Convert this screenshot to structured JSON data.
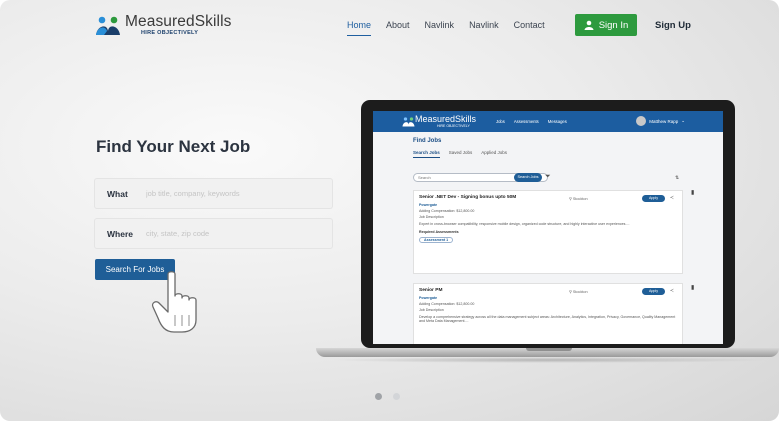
{
  "brand": {
    "name": "MeasuredSkills",
    "tagline": "HIRE OBJECTIVELY",
    "colors": {
      "blue": "#1f5e97",
      "green": "#2d9a3e"
    }
  },
  "nav": {
    "items": [
      "Home",
      "About",
      "Navlink",
      "Navlink",
      "Contact"
    ],
    "active": "Home"
  },
  "auth": {
    "sign_in": "Sign In",
    "sign_up": "Sign Up"
  },
  "hero": {
    "title": "Find Your Next Job",
    "what_label": "What",
    "what_placeholder": "job title, company, keywords",
    "where_label": "Where",
    "where_placeholder": "city, state, zip code",
    "search_button": "Search For Jobs"
  },
  "preview": {
    "logo": "MeasuredSkills",
    "logo_tag": "HIRE OBJECTIVELY",
    "nav": [
      "Jobs",
      "Assessments",
      "Messages"
    ],
    "user": "Matthew Rapp",
    "title": "Find Jobs",
    "tabs": [
      "Search Jobs",
      "Saved Jobs",
      "Applied Jobs"
    ],
    "search_placeholder": "Search",
    "search_button": "Search Jobs",
    "jobs": [
      {
        "title": "Senior .NET Dev - Signing bonus upto 50M",
        "location": "Stockton",
        "apply": "Apply",
        "company": "Powergate",
        "comp": "Adding Compensation: $12,800.00",
        "desc_label": "Job Description",
        "desc": "Expert in cross-browser compatibility, responsive mobile design, organized code structure, and highly interactive user experiences....",
        "req": "Required Assessments",
        "assessment": "Assessment 1"
      },
      {
        "title": "Senior PM",
        "location": "Stockton",
        "apply": "Apply",
        "company": "Powergate",
        "comp": "Adding Compensation: $12,800.00",
        "desc_label": "Job Description",
        "desc": "Develop a comprehensive strategy across all the data management subject areas: Architecture, Analytics, Integration, Privacy, Governance, Quality Management and Meta Data Management...."
      }
    ]
  },
  "carousel": {
    "count": 2,
    "active": 1
  }
}
